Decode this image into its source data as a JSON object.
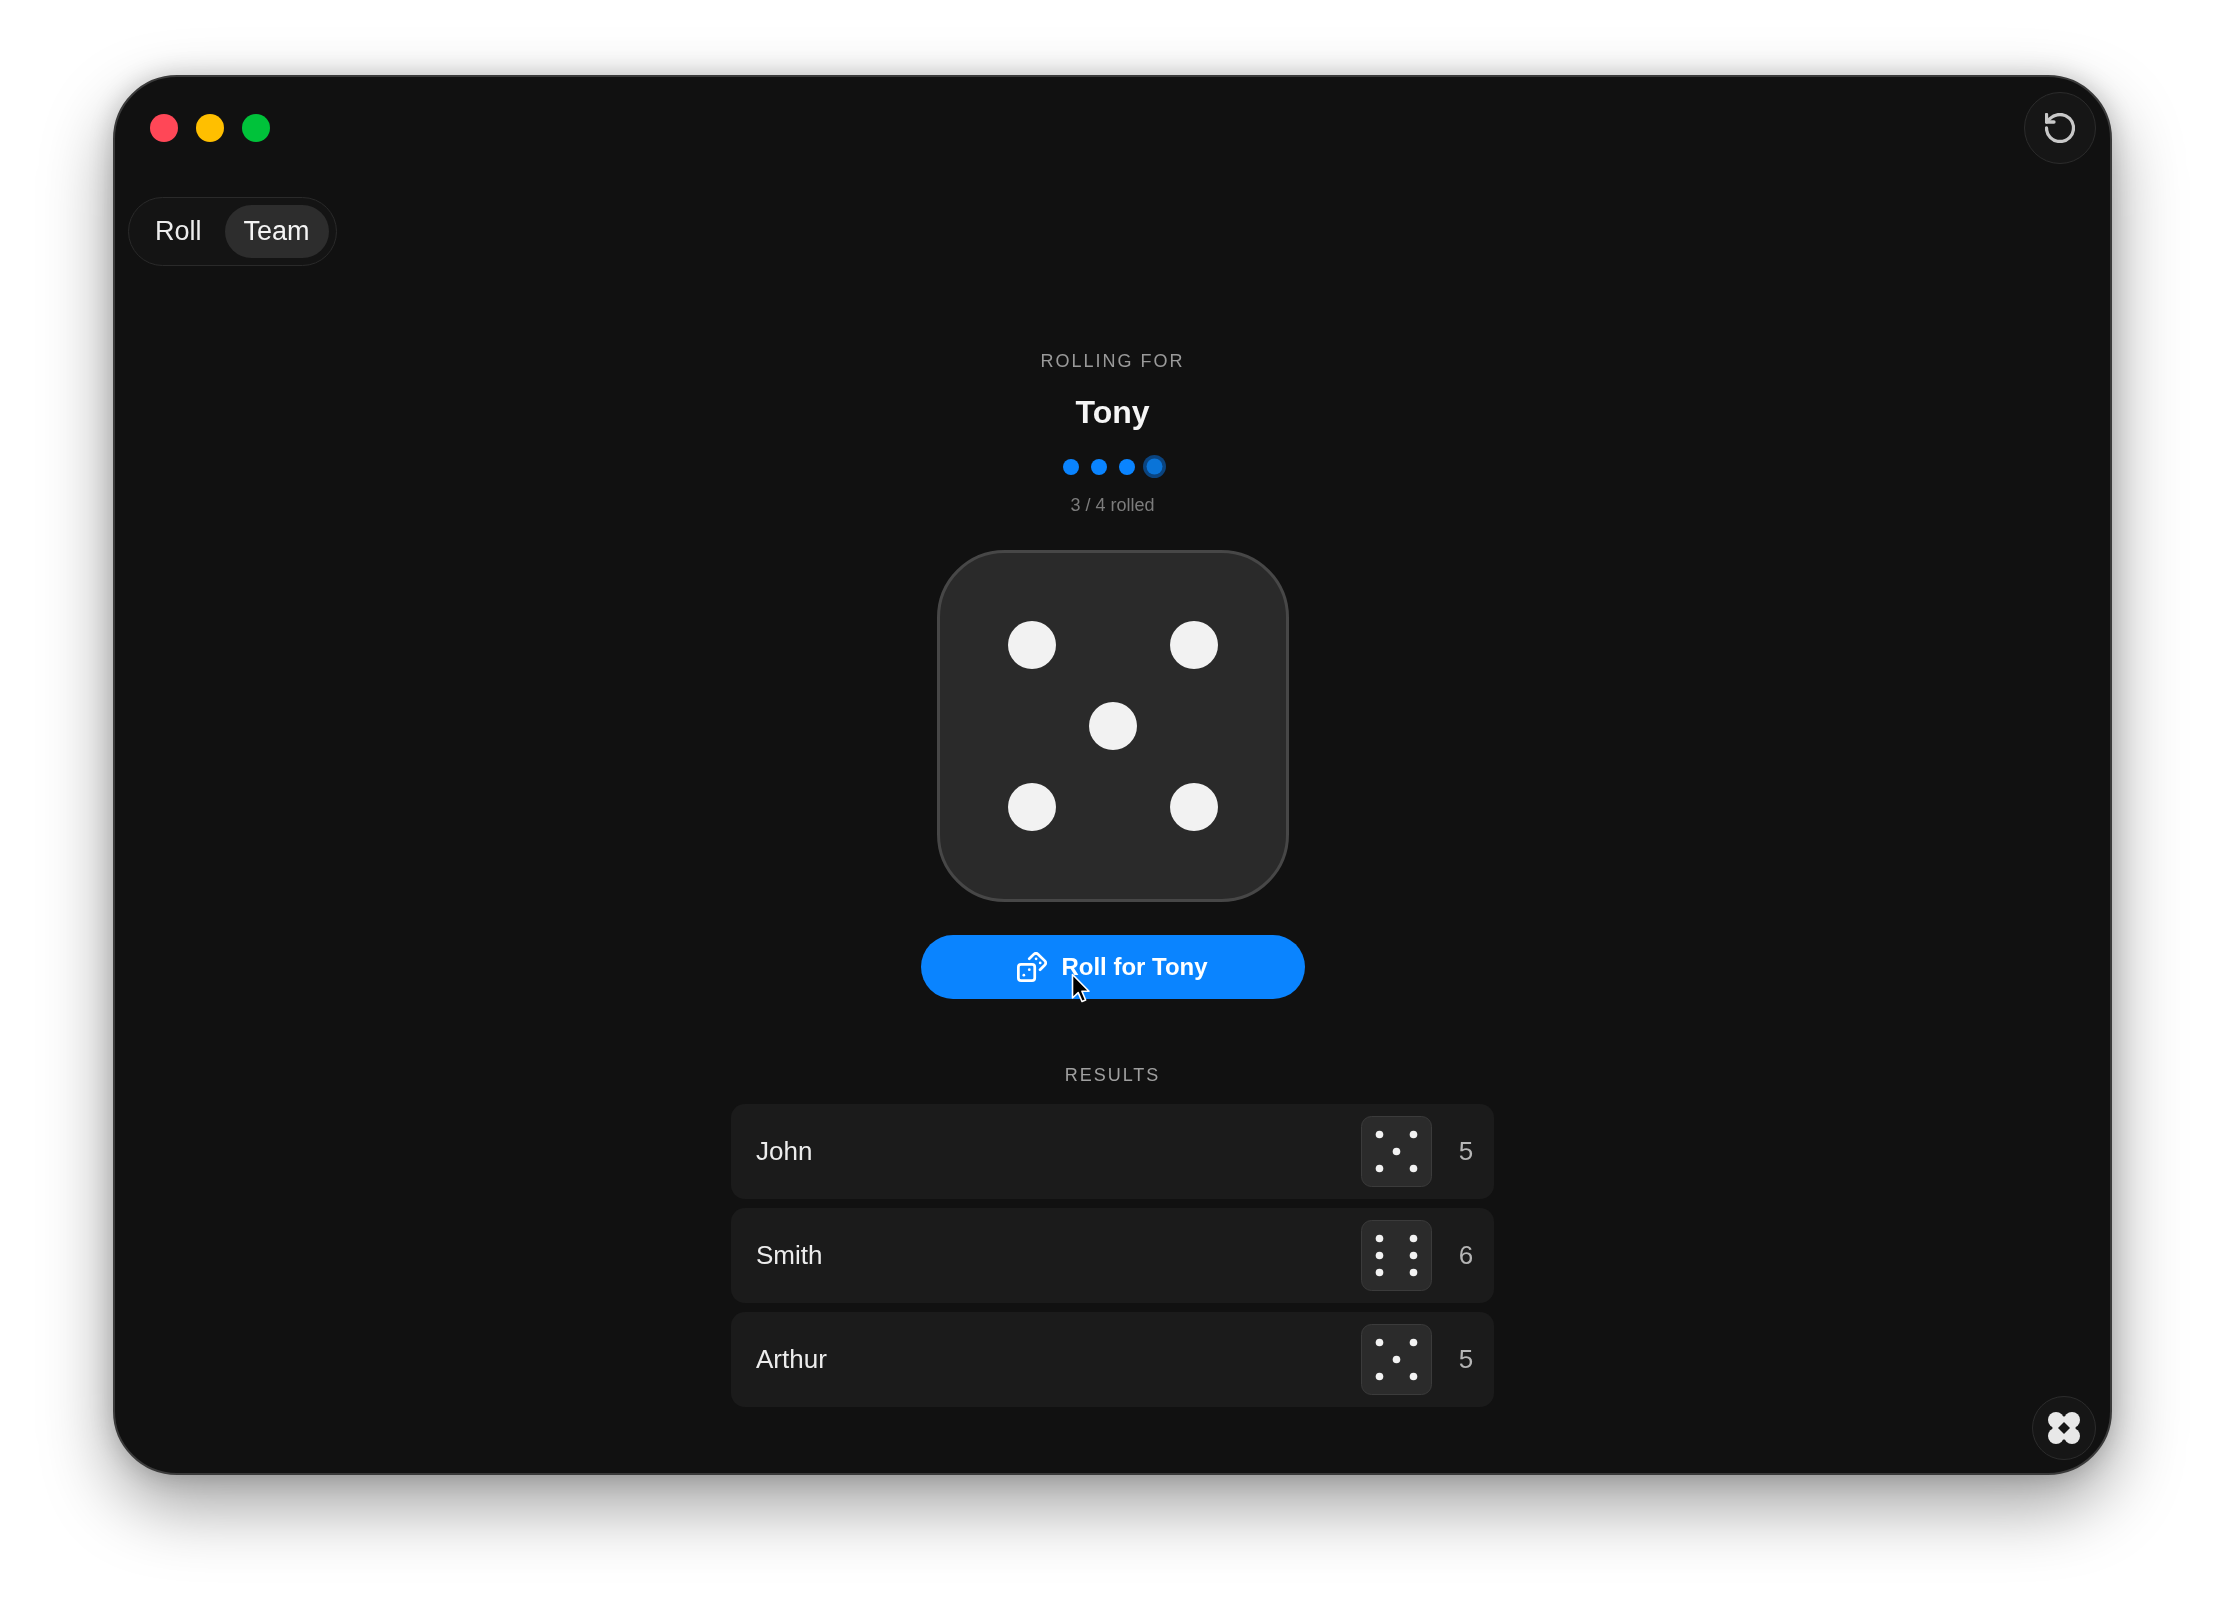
{
  "tabs": [
    {
      "label": "Roll",
      "selected": false
    },
    {
      "label": "Team",
      "selected": true
    }
  ],
  "header": {
    "caption": "ROLLING FOR",
    "player": "Tony",
    "progress": [
      {
        "rolled": true,
        "selected": false
      },
      {
        "rolled": true,
        "selected": false
      },
      {
        "rolled": true,
        "selected": false
      },
      {
        "rolled": false,
        "selected": true
      }
    ],
    "progress_text": "3 / 4 rolled"
  },
  "die": {
    "kind": "five"
  },
  "roll_button": {
    "label": "Roll for Tony"
  },
  "results": {
    "title": "RESULTS",
    "rows": [
      {
        "kind": "five",
        "name": "John",
        "score": "5"
      },
      {
        "kind": "six",
        "name": "Smith",
        "score": "6"
      },
      {
        "kind": "five",
        "name": "Arthur",
        "score": "5"
      }
    ]
  }
}
